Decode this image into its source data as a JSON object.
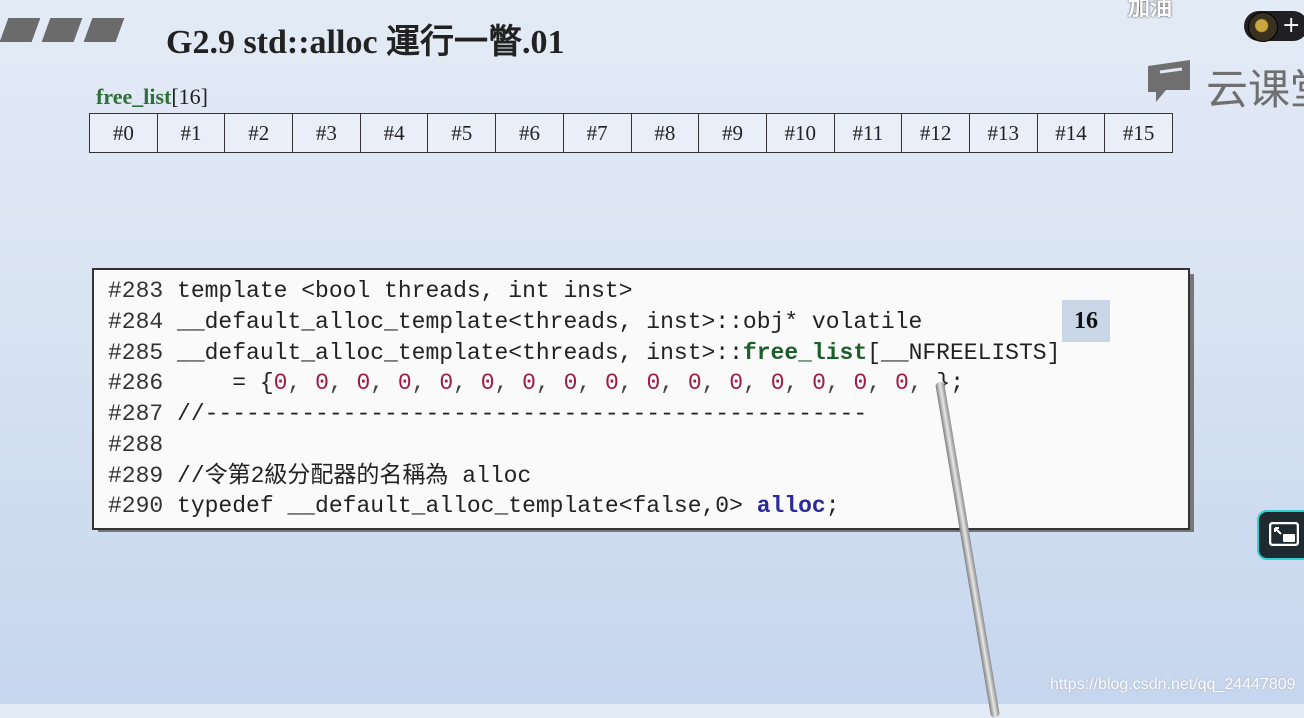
{
  "overlay": {
    "top_text": "加油",
    "plus": "+"
  },
  "slide": {
    "title": "G2.9 std::alloc 運行一瞥.01"
  },
  "logo": {
    "text": "云课堂"
  },
  "free_list": {
    "name": "free_list",
    "size": "[16]",
    "cells": [
      "#0",
      "#1",
      "#2",
      "#3",
      "#4",
      "#5",
      "#6",
      "#7",
      "#8",
      "#9",
      "#10",
      "#11",
      "#12",
      "#13",
      "#14",
      "#15"
    ]
  },
  "code": {
    "l283": {
      "no": "#283",
      "text": " template <bool threads, int inst>"
    },
    "l284": {
      "no": "#284",
      "text": " __default_alloc_template<threads, inst>::obj* volatile"
    },
    "l285": {
      "no": "#285",
      "pre": " __default_alloc_template<threads, inst>::",
      "kw": "free_list",
      "post": "[__NFREELISTS]"
    },
    "l286": {
      "no": "#286",
      "pre": "     = {",
      "zeros": [
        "0",
        "0",
        "0",
        "0",
        "0",
        "0",
        "0",
        "0",
        "0",
        "0",
        "0",
        "0",
        "0",
        "0",
        "0",
        "0"
      ],
      "post": " };"
    },
    "l287": {
      "no": "#287",
      "text": " //------------------------------------------------"
    },
    "l288": {
      "no": "#288"
    },
    "l289": {
      "no": "#289",
      "text": " //令第2級分配器的名稱為 alloc"
    },
    "l290": {
      "no": "#290",
      "pre": " typedef __default_alloc_template<false,0> ",
      "kw": "alloc",
      "post": ";"
    }
  },
  "badge": "16",
  "watermark": "https://blog.csdn.net/qq_24447809"
}
